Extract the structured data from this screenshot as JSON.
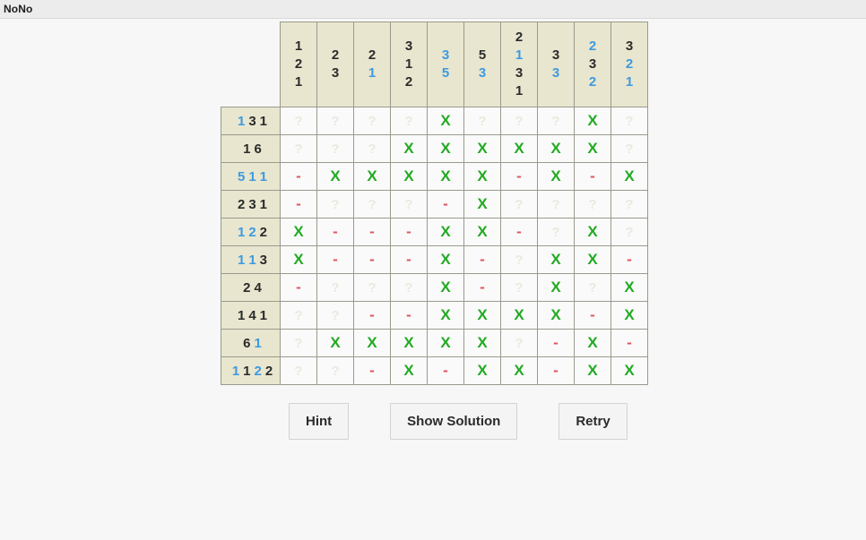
{
  "window": {
    "title": "NoNo"
  },
  "puzzle": {
    "rows": 10,
    "cols": 10,
    "colors": {
      "clue_dark": "#2b2b2b",
      "clue_blue": "#3d9ae0",
      "filled_x": "#22aa22",
      "blocked_dash": "#e05560",
      "unknown": "#ebe9de",
      "clue_background": "#e8e6ce",
      "cell_background": "#fafafa",
      "grid_line": "#9a9a8e"
    },
    "glyphs": {
      "filled": "X",
      "blocked": "-",
      "unknown": "?"
    },
    "column_clues": [
      {
        "index": 1,
        "numbers": [
          {
            "value": "1",
            "color": "dark"
          },
          {
            "value": "2",
            "color": "dark"
          },
          {
            "value": "1",
            "color": "dark"
          }
        ]
      },
      {
        "index": 2,
        "numbers": [
          {
            "value": "2",
            "color": "dark"
          },
          {
            "value": "3",
            "color": "dark"
          }
        ]
      },
      {
        "index": 3,
        "numbers": [
          {
            "value": "2",
            "color": "dark"
          },
          {
            "value": "1",
            "color": "blue"
          }
        ]
      },
      {
        "index": 4,
        "numbers": [
          {
            "value": "3",
            "color": "dark"
          },
          {
            "value": "1",
            "color": "dark"
          },
          {
            "value": "2",
            "color": "dark"
          }
        ]
      },
      {
        "index": 5,
        "numbers": [
          {
            "value": "3",
            "color": "blue"
          },
          {
            "value": "5",
            "color": "blue"
          }
        ]
      },
      {
        "index": 6,
        "numbers": [
          {
            "value": "5",
            "color": "dark"
          },
          {
            "value": "3",
            "color": "blue"
          }
        ]
      },
      {
        "index": 7,
        "numbers": [
          {
            "value": "2",
            "color": "dark"
          },
          {
            "value": "1",
            "color": "blue"
          },
          {
            "value": "3",
            "color": "dark"
          },
          {
            "value": "1",
            "color": "dark"
          }
        ]
      },
      {
        "index": 8,
        "numbers": [
          {
            "value": "3",
            "color": "dark"
          },
          {
            "value": "3",
            "color": "blue"
          }
        ]
      },
      {
        "index": 9,
        "numbers": [
          {
            "value": "2",
            "color": "blue"
          },
          {
            "value": "3",
            "color": "dark"
          },
          {
            "value": "2",
            "color": "blue"
          }
        ]
      },
      {
        "index": 10,
        "numbers": [
          {
            "value": "3",
            "color": "dark"
          },
          {
            "value": "2",
            "color": "blue"
          },
          {
            "value": "1",
            "color": "blue"
          }
        ]
      }
    ],
    "row_clues": [
      {
        "index": 1,
        "numbers": [
          {
            "value": "1",
            "color": "blue"
          },
          {
            "value": "3",
            "color": "dark"
          },
          {
            "value": "1",
            "color": "dark"
          }
        ]
      },
      {
        "index": 2,
        "numbers": [
          {
            "value": "1",
            "color": "dark"
          },
          {
            "value": "6",
            "color": "dark"
          }
        ]
      },
      {
        "index": 3,
        "numbers": [
          {
            "value": "5",
            "color": "blue"
          },
          {
            "value": "1",
            "color": "blue"
          },
          {
            "value": "1",
            "color": "blue"
          }
        ]
      },
      {
        "index": 4,
        "numbers": [
          {
            "value": "2",
            "color": "dark"
          },
          {
            "value": "3",
            "color": "dark"
          },
          {
            "value": "1",
            "color": "dark"
          }
        ]
      },
      {
        "index": 5,
        "numbers": [
          {
            "value": "1",
            "color": "blue"
          },
          {
            "value": "2",
            "color": "blue"
          },
          {
            "value": "2",
            "color": "dark"
          }
        ]
      },
      {
        "index": 6,
        "numbers": [
          {
            "value": "1",
            "color": "blue"
          },
          {
            "value": "1",
            "color": "blue"
          },
          {
            "value": "3",
            "color": "dark"
          }
        ]
      },
      {
        "index": 7,
        "numbers": [
          {
            "value": "2",
            "color": "dark"
          },
          {
            "value": "4",
            "color": "dark"
          }
        ]
      },
      {
        "index": 8,
        "numbers": [
          {
            "value": "1",
            "color": "dark"
          },
          {
            "value": "4",
            "color": "dark"
          },
          {
            "value": "1",
            "color": "dark"
          }
        ]
      },
      {
        "index": 9,
        "numbers": [
          {
            "value": "6",
            "color": "dark"
          },
          {
            "value": "1",
            "color": "blue"
          }
        ]
      },
      {
        "index": 10,
        "numbers": [
          {
            "value": "1",
            "color": "blue"
          },
          {
            "value": "1",
            "color": "dark"
          },
          {
            "value": "2",
            "color": "blue"
          },
          {
            "value": "2",
            "color": "dark"
          }
        ]
      }
    ],
    "grid": [
      [
        "unknown",
        "unknown",
        "unknown",
        "unknown",
        "filled",
        "unknown",
        "unknown",
        "unknown",
        "filled",
        "unknown"
      ],
      [
        "unknown",
        "unknown",
        "unknown",
        "filled",
        "filled",
        "filled",
        "filled",
        "filled",
        "filled",
        "unknown"
      ],
      [
        "blocked",
        "filled",
        "filled",
        "filled",
        "filled",
        "filled",
        "blocked",
        "filled",
        "blocked",
        "filled"
      ],
      [
        "blocked",
        "unknown",
        "unknown",
        "unknown",
        "blocked",
        "filled",
        "unknown",
        "unknown",
        "unknown",
        "unknown"
      ],
      [
        "filled",
        "blocked",
        "blocked",
        "blocked",
        "filled",
        "filled",
        "blocked",
        "unknown",
        "filled",
        "unknown"
      ],
      [
        "filled",
        "blocked",
        "blocked",
        "blocked",
        "filled",
        "blocked",
        "unknown",
        "filled",
        "filled",
        "blocked"
      ],
      [
        "blocked",
        "unknown",
        "unknown",
        "unknown",
        "filled",
        "blocked",
        "unknown",
        "filled",
        "unknown",
        "filled"
      ],
      [
        "unknown",
        "unknown",
        "blocked",
        "blocked",
        "filled",
        "filled",
        "filled",
        "filled",
        "blocked",
        "filled"
      ],
      [
        "unknown",
        "filled",
        "filled",
        "filled",
        "filled",
        "filled",
        "unknown",
        "blocked",
        "filled",
        "blocked"
      ],
      [
        "unknown",
        "unknown",
        "blocked",
        "filled",
        "blocked",
        "filled",
        "filled",
        "blocked",
        "filled",
        "filled"
      ]
    ]
  },
  "controls": {
    "hint_label": "Hint",
    "show_solution_label": "Show Solution",
    "retry_label": "Retry"
  }
}
